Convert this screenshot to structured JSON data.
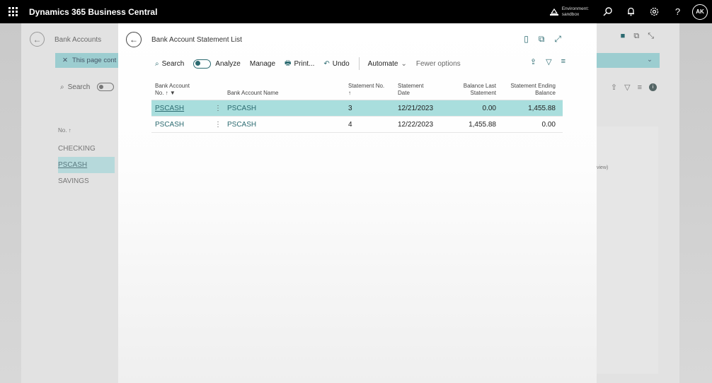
{
  "topbar": {
    "app_title": "Dynamics 365 Business Central",
    "env_label": "Environment:",
    "env_name": "sandbox",
    "avatar": "AK",
    "icons": [
      "waffle-icon",
      "environment-icon",
      "search-icon",
      "bell-icon",
      "gear-icon",
      "help-icon"
    ]
  },
  "background_page": {
    "title": "Bank Accounts",
    "notice": "This page cont",
    "search_label": "Search",
    "column_header": "No. ↑",
    "rows": [
      "CHECKING",
      "PSCASH",
      "SAVINGS"
    ],
    "factbox_text": "is view)"
  },
  "dialog": {
    "title": "Bank Account Statement List",
    "commands": {
      "search": "Search",
      "analyze": "Analyze",
      "manage": "Manage",
      "print": "Print...",
      "undo": "Undo",
      "automate": "Automate",
      "fewer_options": "Fewer options"
    },
    "columns": {
      "bank_account_no_line1": "Bank Account",
      "bank_account_no_line2": "No. ↑ ▼",
      "bank_account_name": "Bank Account Name",
      "statement_no_line1": "Statement No.",
      "statement_no_line2": "↑",
      "statement_date_line1": "Statement",
      "statement_date_line2": "Date",
      "balance_last_line1": "Balance Last",
      "balance_last_line2": "Statement",
      "ending_balance_line1": "Statement Ending",
      "ending_balance_line2": "Balance"
    },
    "rows": [
      {
        "account_no": "PSCASH",
        "account_name": "PSCASH",
        "statement_no": "3",
        "statement_date": "12/21/2023",
        "balance_last": "0.00",
        "ending_balance": "1,455.88"
      },
      {
        "account_no": "PSCASH",
        "account_name": "PSCASH",
        "statement_no": "4",
        "statement_date": "12/22/2023",
        "balance_last": "1,455.88",
        "ending_balance": "0.00"
      }
    ]
  },
  "colors": {
    "accent": "#2b6a70",
    "selected_row": "#a9dedd",
    "topbar": "#000000"
  }
}
